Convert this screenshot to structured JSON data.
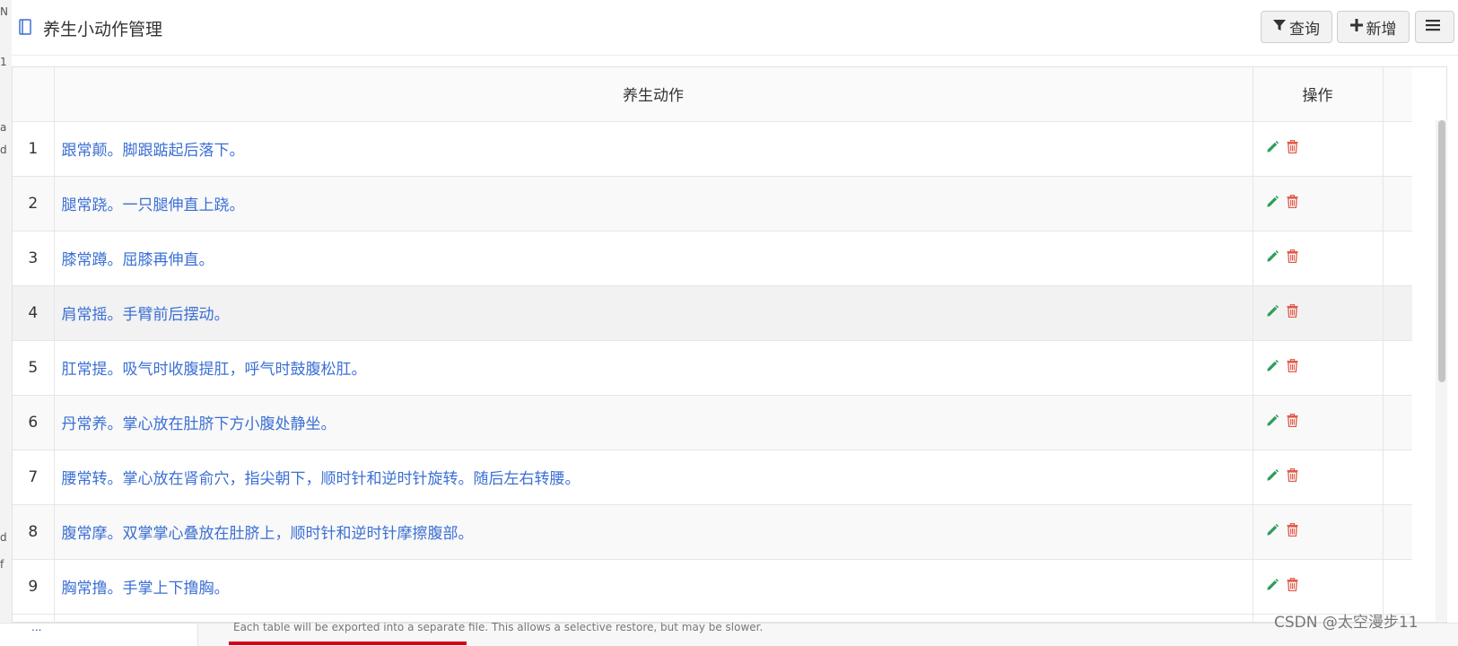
{
  "background": {
    "left_fragments": [
      "N",
      "1",
      "a",
      "d",
      "d",
      "f"
    ],
    "bottom_text": "Each table will be exported into a separate file. This allows a selective restore, but may be slower.",
    "bottom_left_fragment": "..."
  },
  "header": {
    "title": "养生小动作管理",
    "query_label": "查询",
    "add_label": "新增"
  },
  "table": {
    "columns": [
      "",
      "养生动作",
      "操作"
    ],
    "rows": [
      {
        "num": "1",
        "action": "跟常颠。脚跟踮起后落下。"
      },
      {
        "num": "2",
        "action": "腿常跷。一只腿伸直上跷。"
      },
      {
        "num": "3",
        "action": "膝常蹲。屈膝再伸直。"
      },
      {
        "num": "4",
        "action": "肩常摇。手臂前后摆动。"
      },
      {
        "num": "5",
        "action": "肛常提。吸气时收腹提肛，呼气时鼓腹松肛。"
      },
      {
        "num": "6",
        "action": "丹常养。掌心放在肚脐下方小腹处静坐。"
      },
      {
        "num": "7",
        "action": "腰常转。掌心放在肾俞穴，指尖朝下，顺时针和逆时针旋转。随后左右转腰。"
      },
      {
        "num": "8",
        "action": "腹常摩。双掌掌心叠放在肚脐上，顺时针和逆时针摩擦腹部。"
      },
      {
        "num": "9",
        "action": "胸常撸。手掌上下撸胸。"
      }
    ]
  },
  "colors": {
    "link": "#3b6fd4",
    "edit_icon": "#2e9e5b",
    "delete_icon": "#e05a4a"
  },
  "watermark": "CSDN @太空漫步11"
}
